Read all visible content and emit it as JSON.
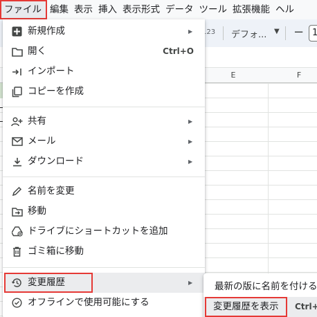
{
  "menubar": {
    "items": [
      "ファイル",
      "編集",
      "表示",
      "挿入",
      "表示形式",
      "データ",
      "ツール",
      "拡張機能",
      "ヘル"
    ]
  },
  "toolbar": {
    "number_format": "123",
    "font": "デフォ...",
    "zoom_caret_icon": "caret-down-icon",
    "minus": "−",
    "font_size": "1"
  },
  "columns": [
    "E",
    "F"
  ],
  "file_menu": {
    "items": [
      {
        "icon": "plus-box-icon",
        "label": "新規作成",
        "shortcut": "",
        "submenu": true
      },
      {
        "icon": "folder-icon",
        "label": "開く",
        "shortcut": "Ctrl+O",
        "submenu": false
      },
      {
        "icon": "import-icon",
        "label": "インポート",
        "shortcut": "",
        "submenu": false
      },
      {
        "icon": "copy-icon",
        "label": "コピーを作成",
        "shortcut": "",
        "submenu": false
      },
      {
        "icon": "person-add-icon",
        "label": "共有",
        "shortcut": "",
        "submenu": true
      },
      {
        "icon": "mail-icon",
        "label": "メール",
        "shortcut": "",
        "submenu": true
      },
      {
        "icon": "download-icon",
        "label": "ダウンロード",
        "shortcut": "",
        "submenu": true
      },
      {
        "icon": "rename-icon",
        "label": "名前を変更",
        "shortcut": "",
        "submenu": false
      },
      {
        "icon": "move-folder-icon",
        "label": "移動",
        "shortcut": "",
        "submenu": false
      },
      {
        "icon": "drive-shortcut-icon",
        "label": "ドライブにショートカットを追加",
        "shortcut": "",
        "submenu": false
      },
      {
        "icon": "trash-icon",
        "label": "ゴミ箱に移動",
        "shortcut": "",
        "submenu": false
      },
      {
        "icon": "history-icon",
        "label": "変更履歴",
        "shortcut": "",
        "submenu": true
      },
      {
        "icon": "offline-icon",
        "label": "オフラインで使用可能にする",
        "shortcut": "",
        "submenu": false
      }
    ]
  },
  "version_submenu": {
    "items": [
      {
        "label": "最新の版に名前を付ける",
        "shortcut": ""
      },
      {
        "label": "変更履歴を表示",
        "shortcut": "Ctrl+A"
      }
    ]
  },
  "colors": {
    "highlight_outline": "#e53935",
    "hover_bg": "#ebecee"
  }
}
